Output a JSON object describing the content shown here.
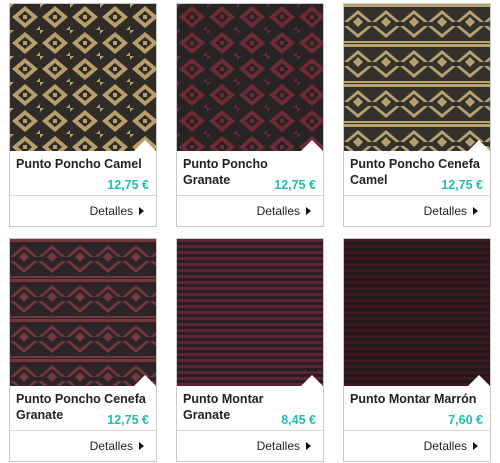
{
  "products": [
    {
      "name": "Punto Poncho Camel",
      "price": "12,75 €",
      "details_label": "Detalles",
      "pattern": "diamond",
      "colors": {
        "base": "#2f2c28",
        "accent": "#b79e6b"
      }
    },
    {
      "name": "Punto Poncho Granate",
      "price": "12,75 €",
      "details_label": "Detalles",
      "pattern": "diamond",
      "colors": {
        "base": "#282426",
        "accent": "#6f2b33"
      }
    },
    {
      "name": "Punto Poncho Cenefa Camel",
      "price": "12,75 €",
      "details_label": "Detalles",
      "pattern": "band",
      "colors": {
        "base": "#34312d",
        "accent": "#b8a26e"
      }
    },
    {
      "name": "Punto Poncho Cenefa Granate",
      "price": "12,75 €",
      "details_label": "Detalles",
      "pattern": "band",
      "colors": {
        "base": "#2d2428",
        "accent": "#73363b"
      }
    },
    {
      "name": "Punto Montar Granate",
      "price": "8,45 €",
      "details_label": "Detalles",
      "pattern": "stripes",
      "colors": {
        "base": "#2a1e24",
        "accent": "#5d2433"
      }
    },
    {
      "name": "Punto Montar Marrón",
      "price": "7,60 €",
      "details_label": "Detalles",
      "pattern": "stripes",
      "colors": {
        "base": "#221719",
        "accent": "#3f181f"
      }
    }
  ],
  "theme": {
    "price_color": "#1fbfae",
    "border_color": "#c9c9c9"
  }
}
